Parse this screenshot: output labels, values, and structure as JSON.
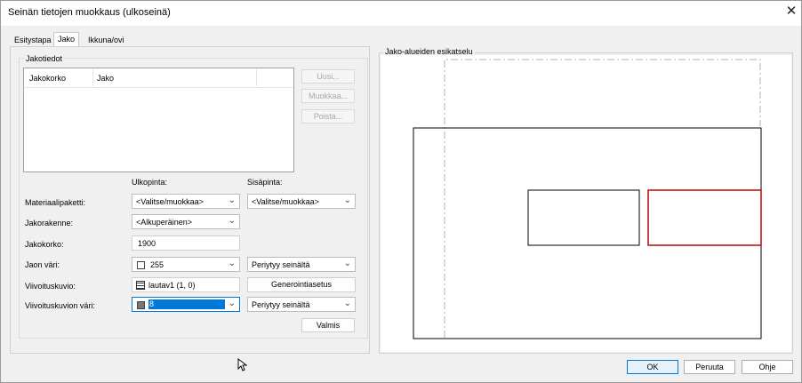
{
  "window": {
    "title": "Seinän tietojen muokkaus (ulkoseinä)",
    "close_glyph": "✕"
  },
  "tabs": [
    {
      "label": "Esitystapa",
      "active": false
    },
    {
      "label": "Jako",
      "active": true
    },
    {
      "label": "Ikkuna/ovi",
      "active": false
    }
  ],
  "jakotiedot": {
    "group_label": "Jakotiedot",
    "columns": [
      "Jakokorko",
      "Jako"
    ],
    "buttons": {
      "new": "Uusi...",
      "edit": "Muokkaa...",
      "delete": "Poista..."
    }
  },
  "form": {
    "outer_header": "Ulkopinta:",
    "inner_header": "Sisäpinta:",
    "materiaali": {
      "label": "Materiaalipaketti:",
      "outer": "<Valitse/muokkaa>",
      "inner": "<Valitse/muokkaa>"
    },
    "jakorakenne": {
      "label": "Jakorakenne:",
      "outer": "<Alkuperäinen>"
    },
    "jakokorko": {
      "label": "Jakokorko:",
      "value": "1900"
    },
    "jaon_vari": {
      "label": "Jaon väri:",
      "outer": "255",
      "inner": "Periytyy seinältä"
    },
    "viivoituskuvio": {
      "label": "Viivoituskuvio:",
      "outer": "lautav1 (1, 0)",
      "inner_button": "Generointiasetus"
    },
    "viivoituskuvion_vari": {
      "label": "Viivoituskuvion väri:",
      "outer": "8",
      "inner": "Periytyy seinältä"
    },
    "done_button": "Valmis"
  },
  "preview": {
    "group_label": "Jako-alueiden esikatselu",
    "colors": {
      "outline": "#000000",
      "highlight": "#c00000",
      "dashed": "#b0b0b0"
    }
  },
  "footer": {
    "ok": "OK",
    "cancel": "Peruuta",
    "help": "Ohje"
  },
  "icons": {
    "combo_arrow": "chevron-down-icon",
    "cursor": "mouse-pointer-icon"
  }
}
